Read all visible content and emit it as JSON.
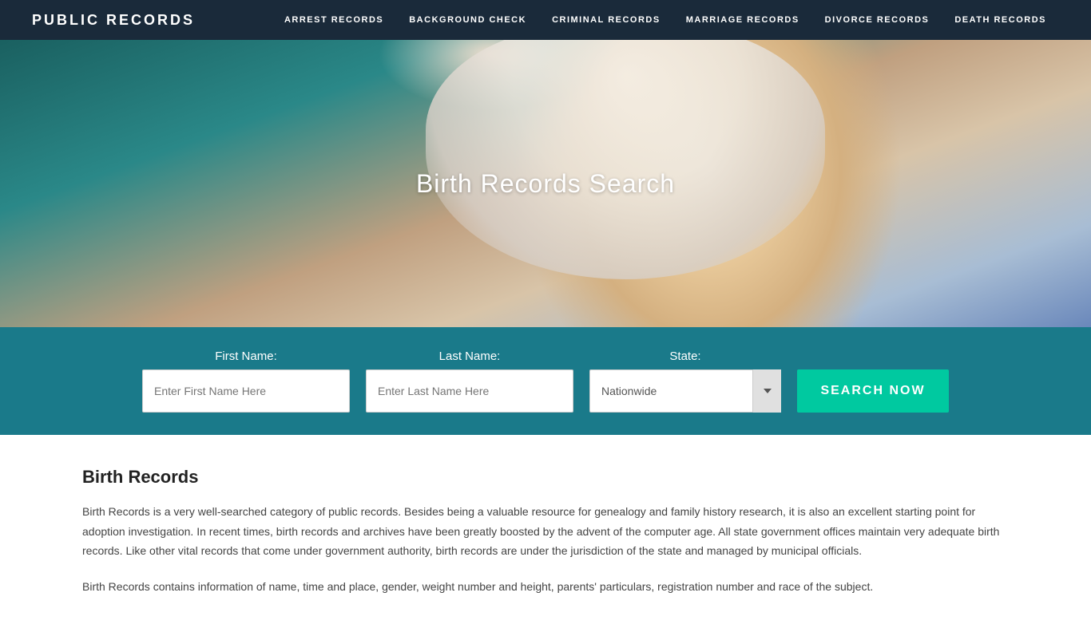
{
  "header": {
    "logo": "PUBLIC RECORDS",
    "nav": [
      {
        "label": "ARREST RECORDS",
        "href": "#"
      },
      {
        "label": "BACKGROUND CHECK",
        "href": "#"
      },
      {
        "label": "CRIMINAL RECORDS",
        "href": "#"
      },
      {
        "label": "MARRIAGE RECORDS",
        "href": "#"
      },
      {
        "label": "DIVORCE RECORDS",
        "href": "#"
      },
      {
        "label": "DEATH RECORDS",
        "href": "#"
      }
    ]
  },
  "hero": {
    "title": "Birth Records Search"
  },
  "search": {
    "first_name_label": "First Name:",
    "first_name_placeholder": "Enter First Name Here",
    "last_name_label": "Last Name:",
    "last_name_placeholder": "Enter Last Name Here",
    "state_label": "State:",
    "state_default": "Nationwide",
    "search_button": "SEARCH NOW"
  },
  "content": {
    "section_title": "Birth Records",
    "paragraph1": "Birth Records is a very well-searched category of public records. Besides being a valuable resource for genealogy and family history research, it is also an excellent starting point for adoption investigation. In recent times, birth records and archives have been greatly boosted by the advent of the computer age. All state government offices maintain very adequate birth records. Like other vital records that come under government authority, birth records are under the jurisdiction of the state and managed by municipal officials.",
    "paragraph2": "Birth Records contains information of name, time and place, gender, weight number and height, parents' particulars, registration number and race of the subject."
  }
}
